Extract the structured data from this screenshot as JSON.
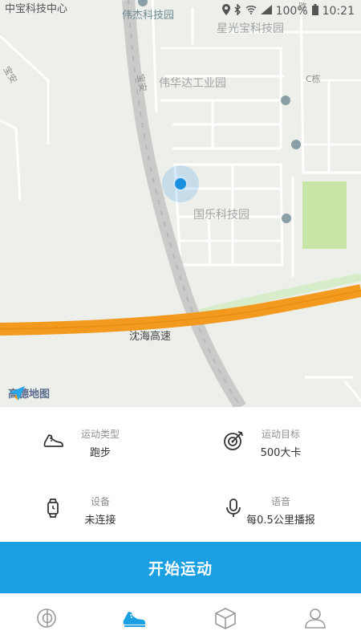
{
  "status_bar": {
    "left_text": "中宝科技中心",
    "battery": "100%",
    "time": "10:21"
  },
  "map": {
    "labels": {
      "weijie": "伟杰科技园",
      "xingguangbao": "星光宝科技园",
      "weihuada": "伟华达工业园",
      "c_building": "C栋",
      "guole": "国乐科技园",
      "shenhai": "沈海高速",
      "road_left": "宝安",
      "road_mid": "宝安",
      "road_top": "路"
    },
    "provider": "高德地图",
    "colors": {
      "highway": "#f39a1e",
      "location": "#1b8fe0"
    }
  },
  "settings": {
    "sport_type": {
      "label": "运动类型",
      "value": "跑步",
      "icon": "running-shoe-icon"
    },
    "sport_goal": {
      "label": "运动目标",
      "value": "500大卡",
      "icon": "target-icon"
    },
    "device": {
      "label": "设备",
      "value": "未连接",
      "icon": "watch-icon"
    },
    "voice": {
      "label": "语音",
      "value": "每0.5公里播报",
      "icon": "microphone-icon"
    }
  },
  "start_button": {
    "label": "开始运动",
    "color": "#1a9fe2"
  },
  "tabbar": {
    "items": [
      {
        "icon": "activity-icon",
        "active": false
      },
      {
        "icon": "running-shoe-icon",
        "active": true
      },
      {
        "icon": "box-icon",
        "active": false
      },
      {
        "icon": "profile-icon",
        "active": false
      }
    ],
    "active_color": "#1a9fe2"
  }
}
